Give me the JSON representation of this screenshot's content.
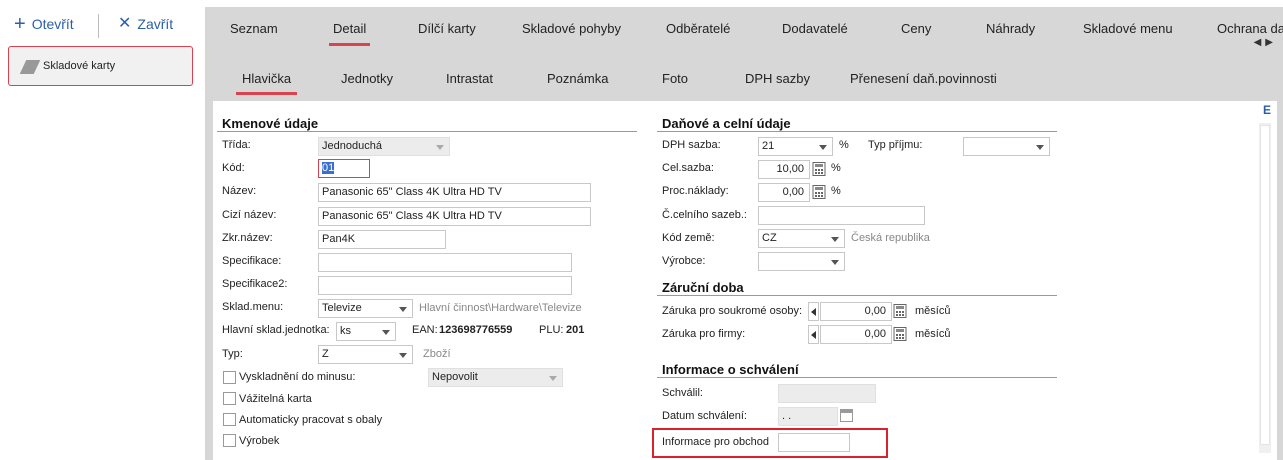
{
  "toolbar": {
    "open_label": "Otevřít",
    "close_label": "Zavřít"
  },
  "nav": {
    "card_label": "Skladové karty"
  },
  "top_tabs": [
    "Seznam",
    "Detail",
    "Dílčí karty",
    "Skladové pohyby",
    "Odběratelé",
    "Dodavatelé",
    "Ceny",
    "Náhrady",
    "Skladové menu",
    "Ochrana da"
  ],
  "sub_tabs": [
    "Hlavička",
    "Jednotky",
    "Intrastat",
    "Poznámka",
    "Foto",
    "DPH sazby",
    "Přenesení daň.povinnosti"
  ],
  "left": {
    "title": "Kmenové údaje",
    "trida_label": "Třída:",
    "trida_value": "Jednoduchá",
    "kod_label": "Kód:",
    "kod_value": "01",
    "nazev_label": "Název:",
    "nazev_value": "Panasonic 65\" Class 4K Ultra HD TV",
    "cizi_label": "Cizí název:",
    "cizi_value": "Panasonic 65\" Class 4K Ultra HD TV",
    "zkr_label": "Zkr.název:",
    "zkr_value": "Pan4K",
    "spec_label": "Specifikace:",
    "spec_value": "",
    "spec2_label": "Specifikace2:",
    "spec2_value": "",
    "sklmenu_label": "Sklad.menu:",
    "sklmenu_value": "Televize",
    "sklmenu_hint": "Hlavní činnost\\Hardware\\Televize",
    "jednotka_label": "Hlavní sklad.jednotka:",
    "jednotka_value": "ks",
    "ean_label": "EAN:",
    "ean_value": "123698776559",
    "plu_label": "PLU:",
    "plu_value": "201",
    "typ_label": "Typ:",
    "typ_value": "Z",
    "typ_hint": "Zboží",
    "vyskl_label": "Vyskladnění do minusu:",
    "vyskl_value": "Nepovolit",
    "vazitelna_label": "Vážitelná karta",
    "obaly_label": "Automaticky pracovat s obaly",
    "vyrobek_label": "Výrobek"
  },
  "right": {
    "title": "Daňové a celní údaje",
    "dph_label": "DPH sazba:",
    "dph_value": "21",
    "pct": "%",
    "typprijmu_label": "Typ příjmu:",
    "typprijmu_value": "",
    "cel_label": "Cel.sazba:",
    "cel_value": "10,00",
    "proc_label": "Proc.náklady:",
    "proc_value": "0,00",
    "celniho_label": "Č.celního sazeb.:",
    "celniho_value": "",
    "zeme_label": "Kód země:",
    "zeme_value": "CZ",
    "zeme_hint": "Česká republika",
    "vyrobce_label": "Výrobce:",
    "vyrobce_value": "",
    "zaruka_title": "Záruční doba",
    "soukr_label": "Záruka pro soukromé osoby:",
    "soukr_value": "0,00",
    "soukr_unit": "měsíců",
    "firmy_label": "Záruka pro firmy:",
    "firmy_value": "0,00",
    "firmy_unit": "měsíců",
    "schvaleni_title": "Informace o schválení",
    "schvalil_label": "Schválil:",
    "schvalil_value": "",
    "datum_label": "Datum schválení:",
    "datum_value": " .  .",
    "obchod_label": "Informace pro obchod",
    "obchod_value": ""
  },
  "colors": {
    "accent": "#d9434f",
    "highlight_box": "#d9232b",
    "link": "#2b5fa8"
  }
}
